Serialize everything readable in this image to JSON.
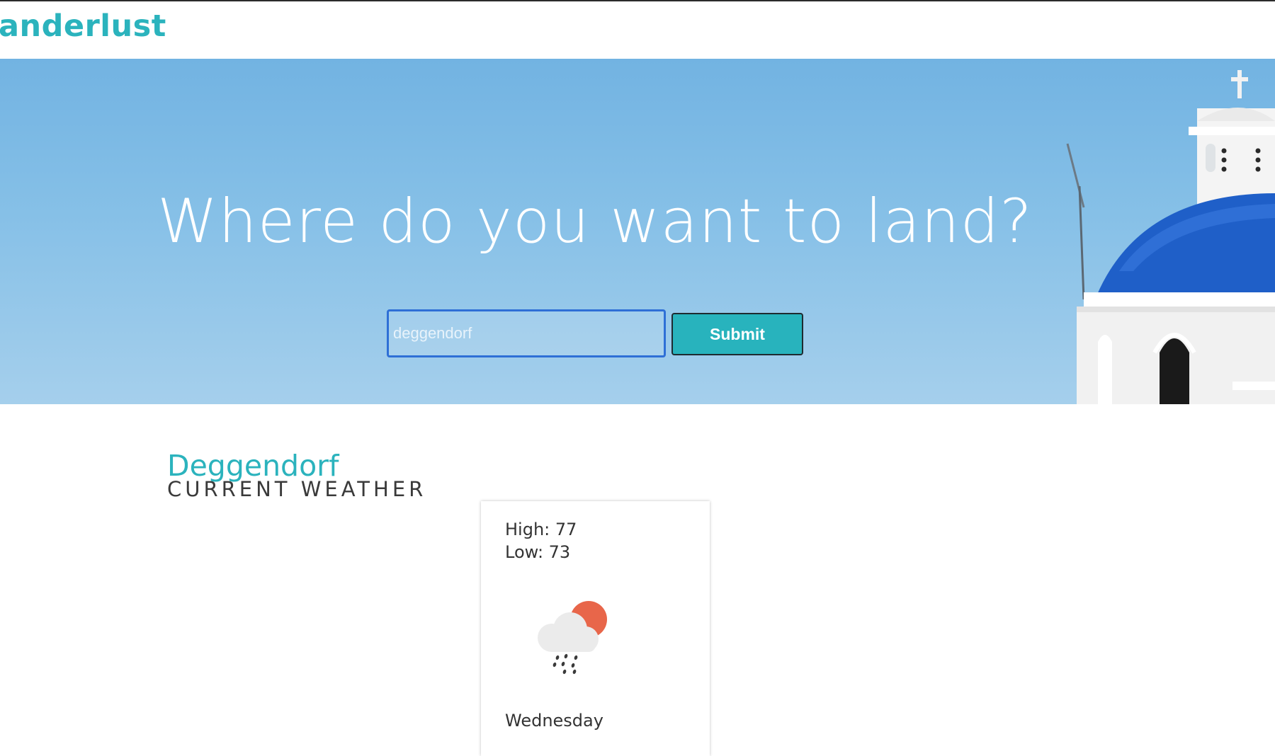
{
  "header": {
    "logo_text": "anderlust"
  },
  "hero": {
    "title": "Where do you want to land?",
    "search": {
      "value": "deggendorf",
      "placeholder": ""
    },
    "submit_label": "Submit"
  },
  "weather": {
    "city": "Deggendorf",
    "subtitle": "CURRENT WEATHER",
    "card": {
      "high_text": "High: 77",
      "low_text": "Low: 73",
      "day": "Wednesday",
      "icon": "rain-cloud-sun-icon"
    }
  },
  "colors": {
    "accent": "#2bb3bd",
    "input_border": "#2e6fd6",
    "sun": "#e8664a",
    "dome": "#1f5fc8"
  }
}
